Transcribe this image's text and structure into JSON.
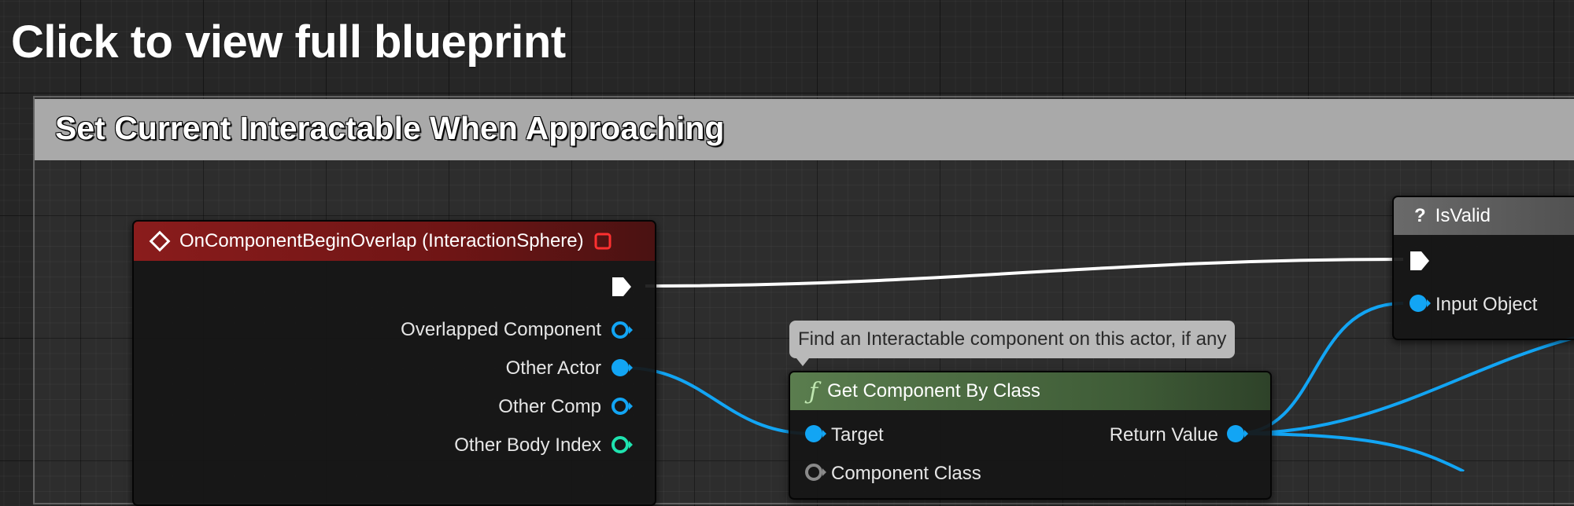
{
  "banner": {
    "text": "Click to view full blueprint"
  },
  "comment": {
    "title": "Set Current Interactable When Approaching"
  },
  "event_node": {
    "title": "OnComponentBeginOverlap (InteractionSphere)",
    "pins": {
      "overlapped_component": "Overlapped Component",
      "other_actor": "Other Actor",
      "other_comp": "Other Comp",
      "other_body_index": "Other Body Index"
    }
  },
  "isvalid_node": {
    "title": "IsValid",
    "icon_glyph": "?",
    "pins": {
      "input_object": "Input Object"
    }
  },
  "tooltip": {
    "text": "Find an Interactable component on this actor, if any"
  },
  "getcomp_node": {
    "title": "Get Component By Class",
    "icon_glyph": "ƒ",
    "pins": {
      "target": "Target",
      "return_value": "Return Value",
      "component_class": "Component Class"
    }
  },
  "colors": {
    "exec_pin": "#ffffff",
    "object_pin": "#12a5f4",
    "int_pin": "#1fe3af",
    "event_header": "#8a1c1c",
    "function_header": "#5a7d4e",
    "pure_header": "#6a6a6a"
  }
}
